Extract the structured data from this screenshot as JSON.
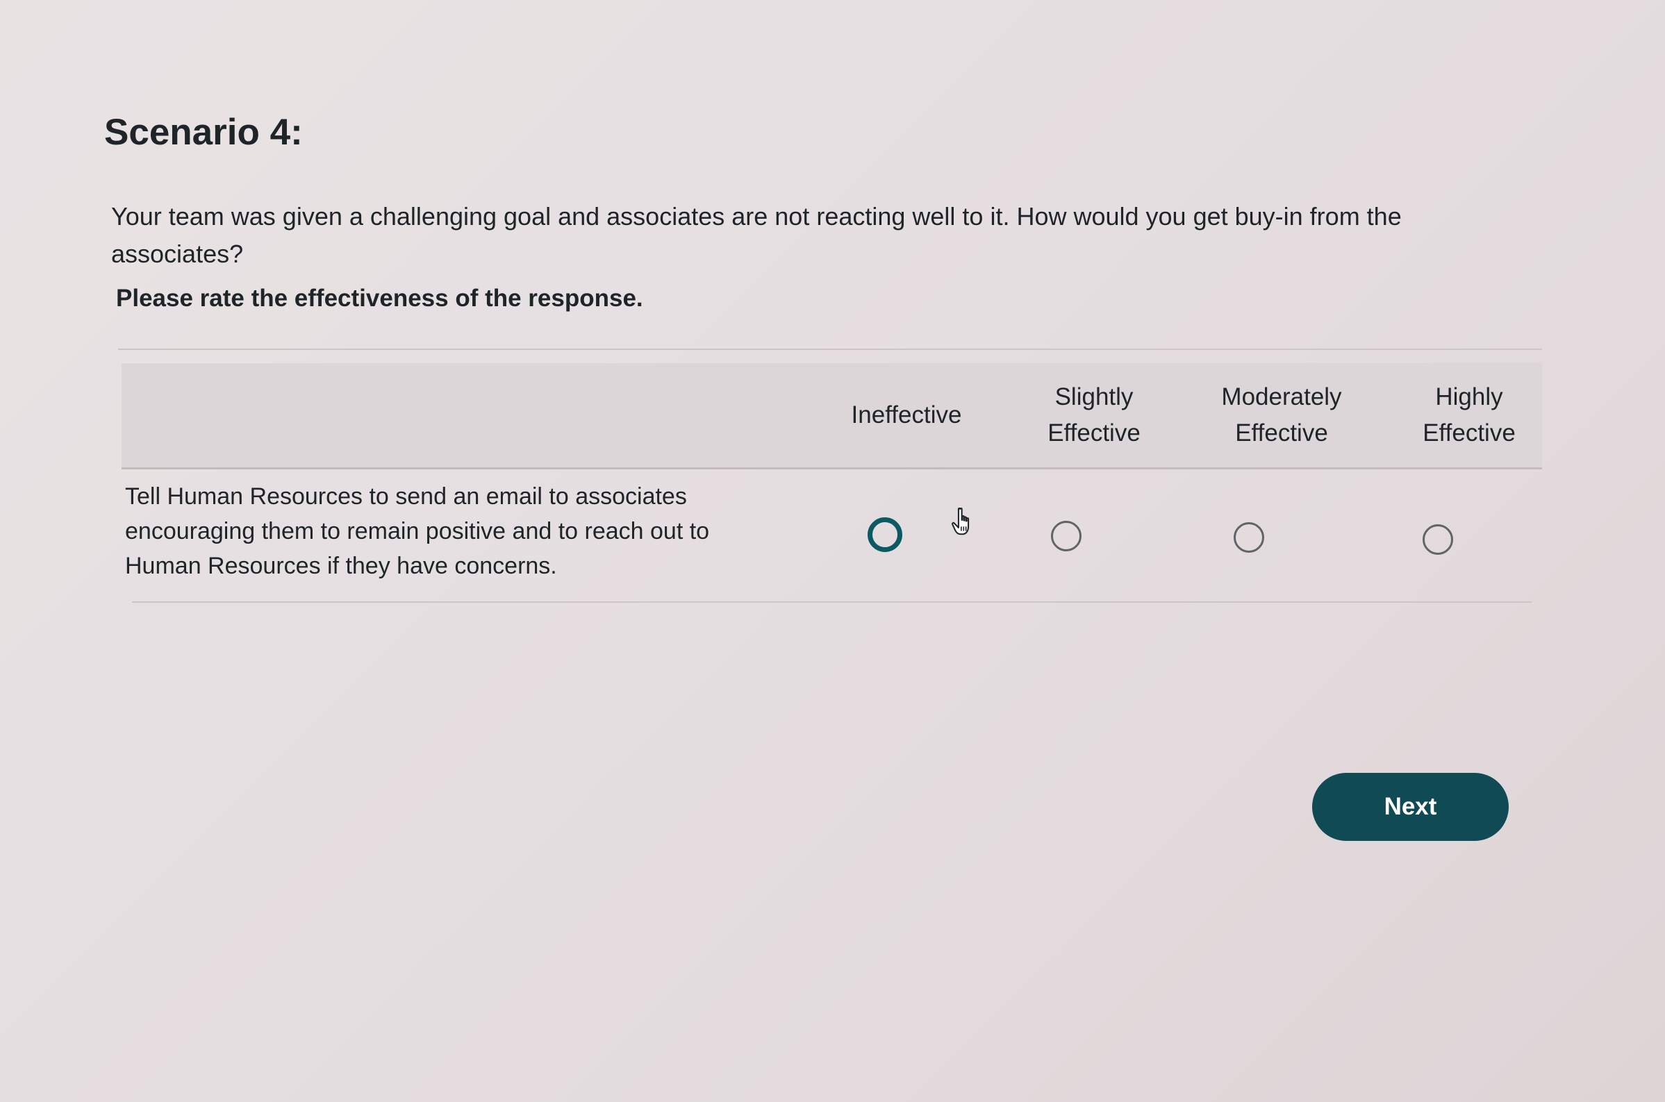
{
  "scenario": {
    "title": "Scenario 4:",
    "question": "Your team was given a challenging goal and associates are not reacting well to it. How would you get buy-in from the associates?",
    "instruction": "Please rate the effectiveness of the response."
  },
  "table": {
    "columns": [
      {
        "line1": "Ineffective",
        "line2": ""
      },
      {
        "line1": "Slightly",
        "line2": "Effective"
      },
      {
        "line1": "Moderately",
        "line2": "Effective"
      },
      {
        "line1": "Highly",
        "line2": "Effective"
      }
    ],
    "rows": [
      {
        "response": "Tell Human Resources to send an email to associates encouraging them to remain positive and to reach out to Human Resources if they have concerns.",
        "selected": null,
        "focused_option": "Ineffective"
      }
    ]
  },
  "actions": {
    "next_label": "Next"
  },
  "colors": {
    "accent": "#0f4a55",
    "focus_ring": "#0b5a63"
  },
  "icons": {
    "cursor": "hand-pointer-icon"
  }
}
